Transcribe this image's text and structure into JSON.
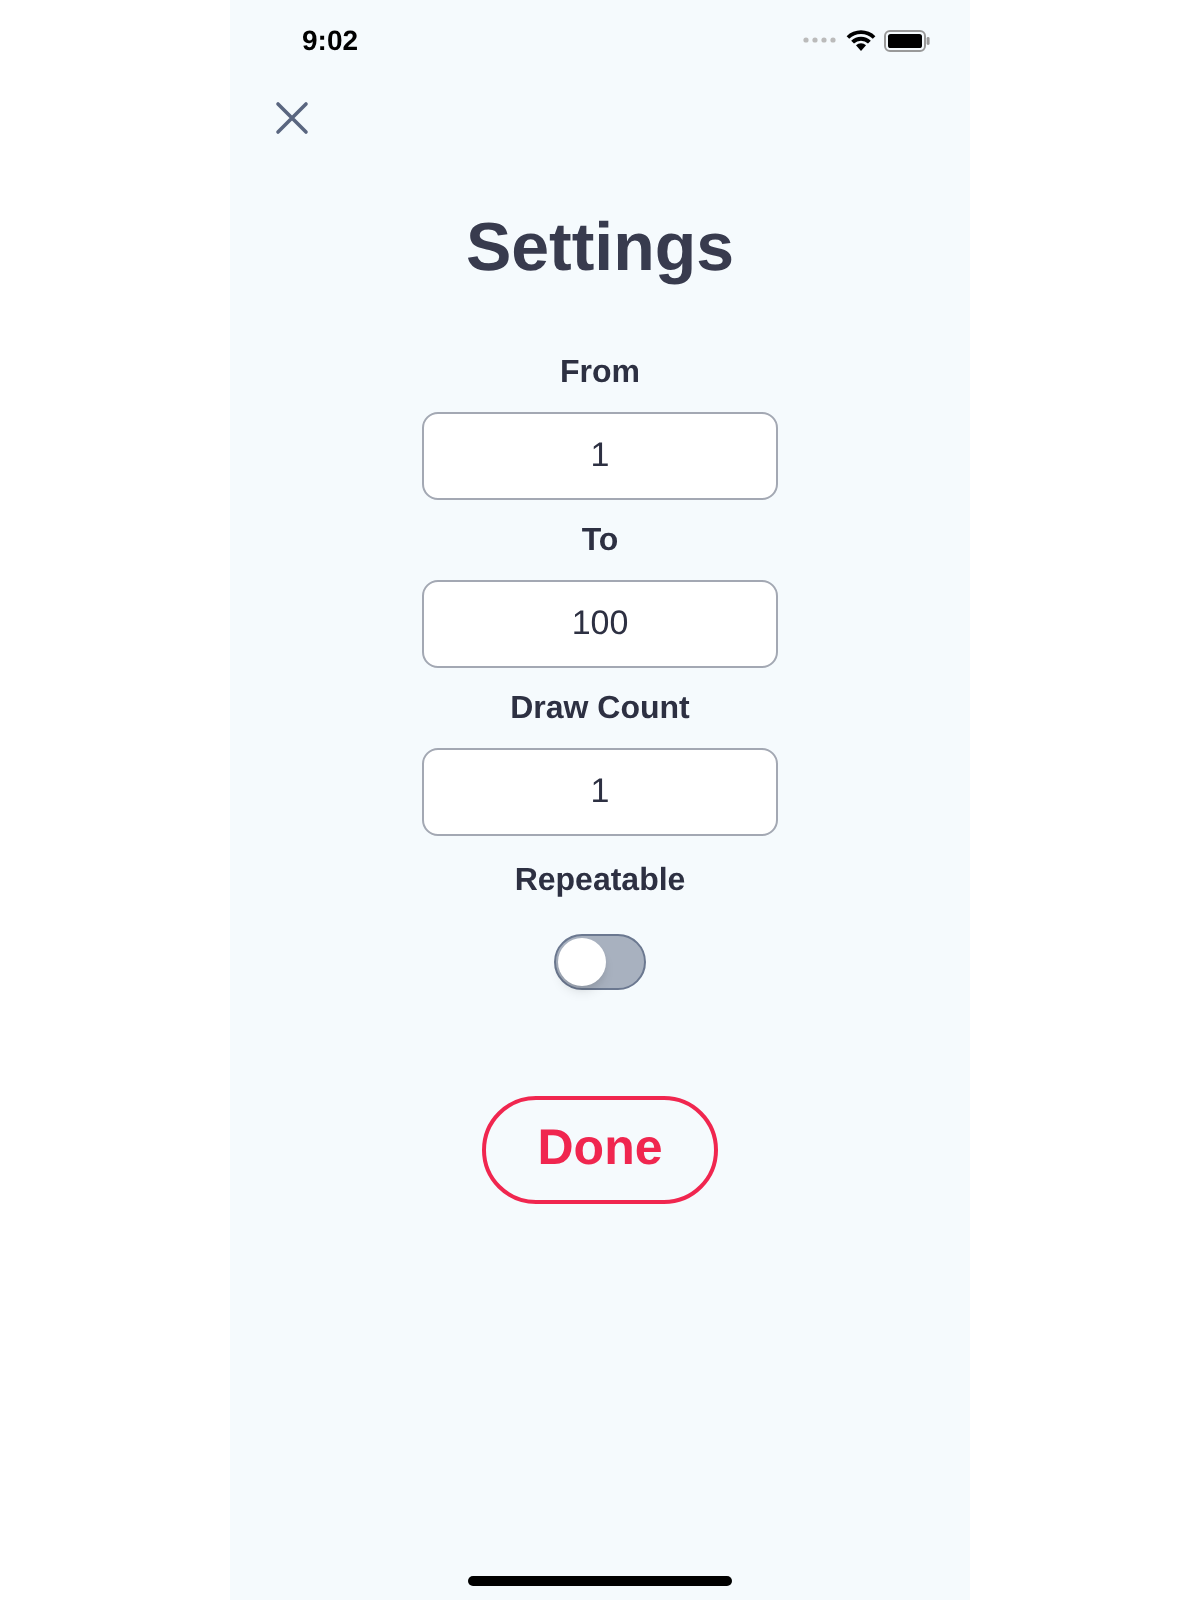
{
  "status_bar": {
    "time": "9:02"
  },
  "title": "Settings",
  "fields": [
    {
      "label": "From",
      "value": "1"
    },
    {
      "label": "To",
      "value": "100"
    },
    {
      "label": "Draw Count",
      "value": "1"
    }
  ],
  "toggle": {
    "label": "Repeatable",
    "on": false
  },
  "done_button": {
    "label": "Done"
  }
}
